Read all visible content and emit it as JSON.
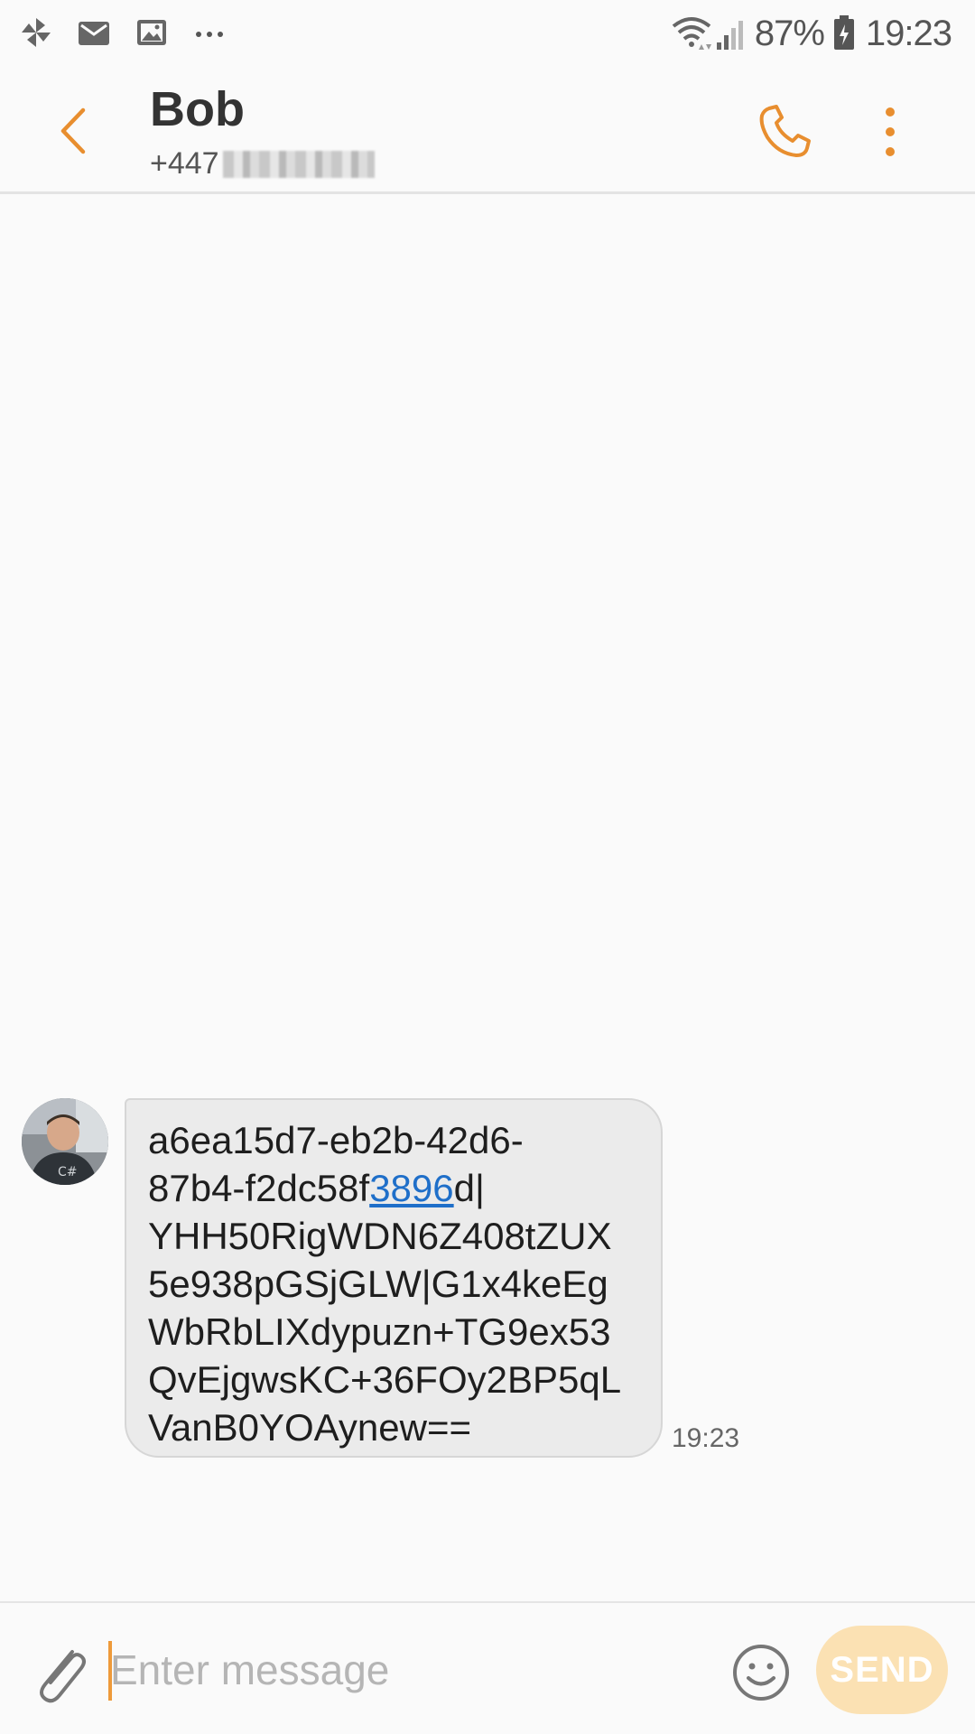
{
  "status_bar": {
    "notification_icons": [
      "pinwheel-icon",
      "mail-icon",
      "gallery-icon",
      "more-notifications-icon"
    ],
    "battery": "87%",
    "time": "19:23"
  },
  "header": {
    "contact_name": "Bob",
    "contact_number_visible": "+447"
  },
  "conversation": {
    "messages": [
      {
        "direction": "incoming",
        "lines": [
          {
            "pre": "a6ea15d7-eb2b-42d6-",
            "link": "",
            "post": ""
          },
          {
            "pre": "87b4-f2dc58f",
            "link": "3896",
            "post": "d|"
          },
          {
            "pre": "YHH50RigWDN6Z408tZUX",
            "link": "",
            "post": ""
          },
          {
            "pre": "5e938pGSjGLW|G1x4keEg",
            "link": "",
            "post": ""
          },
          {
            "pre": "WbRbLIXdypuzn+TG9ex53",
            "link": "",
            "post": ""
          },
          {
            "pre": "QvEjgwsKC+36FOy2BP5qL",
            "link": "",
            "post": ""
          },
          {
            "pre": "VanB0YOAynew==",
            "link": "",
            "post": ""
          }
        ],
        "time": "19:23"
      }
    ]
  },
  "composer": {
    "placeholder": "Enter message",
    "value": "",
    "send_label": "SEND"
  },
  "colors": {
    "accent": "#e88e2f",
    "bubble_incoming": "#ebebeb",
    "link": "#1f6fc9",
    "send_disabled": "#fbe1b3"
  }
}
